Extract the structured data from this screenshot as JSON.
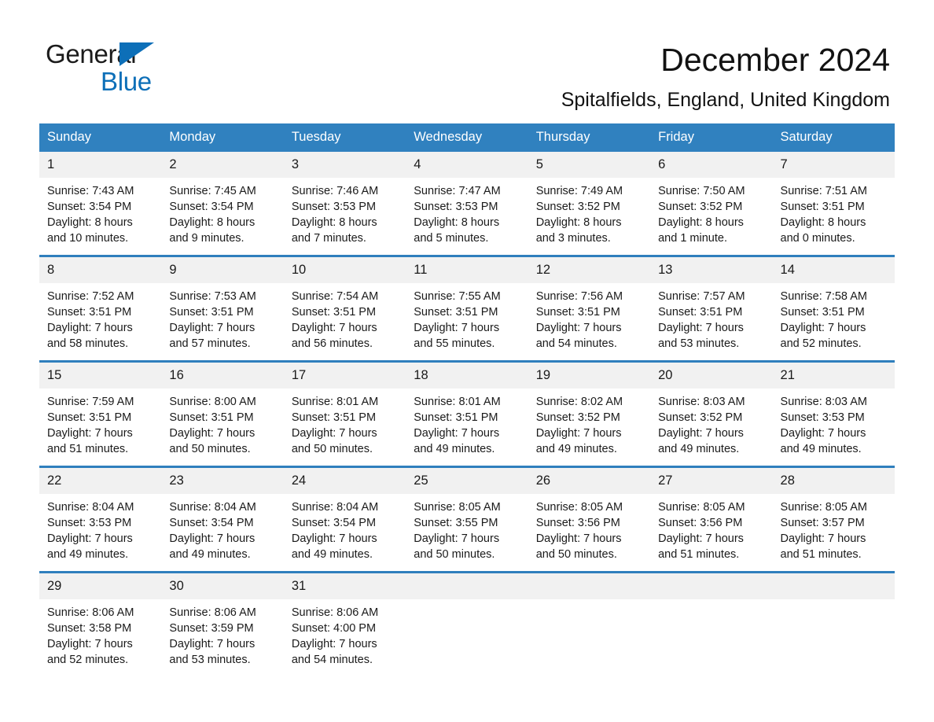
{
  "brand": {
    "name_part1": "General",
    "name_part2": "Blue",
    "flag_icon": "triangle-flag-icon",
    "accent_color": "#0d6fb8"
  },
  "header": {
    "title": "December 2024",
    "subtitle": "Spitalfields, England, United Kingdom"
  },
  "calendar": {
    "header_bg_color": "#3081bf",
    "daynum_bg_color": "#f1f1f1",
    "row_divider_color": "#2f7fbd",
    "weekday_headers": [
      "Sunday",
      "Monday",
      "Tuesday",
      "Wednesday",
      "Thursday",
      "Friday",
      "Saturday"
    ],
    "weeks": [
      [
        {
          "day": "1",
          "sunrise": "Sunrise: 7:43 AM",
          "sunset": "Sunset: 3:54 PM",
          "daylight_line1": "Daylight: 8 hours",
          "daylight_line2": "and 10 minutes."
        },
        {
          "day": "2",
          "sunrise": "Sunrise: 7:45 AM",
          "sunset": "Sunset: 3:54 PM",
          "daylight_line1": "Daylight: 8 hours",
          "daylight_line2": "and 9 minutes."
        },
        {
          "day": "3",
          "sunrise": "Sunrise: 7:46 AM",
          "sunset": "Sunset: 3:53 PM",
          "daylight_line1": "Daylight: 8 hours",
          "daylight_line2": "and 7 minutes."
        },
        {
          "day": "4",
          "sunrise": "Sunrise: 7:47 AM",
          "sunset": "Sunset: 3:53 PM",
          "daylight_line1": "Daylight: 8 hours",
          "daylight_line2": "and 5 minutes."
        },
        {
          "day": "5",
          "sunrise": "Sunrise: 7:49 AM",
          "sunset": "Sunset: 3:52 PM",
          "daylight_line1": "Daylight: 8 hours",
          "daylight_line2": "and 3 minutes."
        },
        {
          "day": "6",
          "sunrise": "Sunrise: 7:50 AM",
          "sunset": "Sunset: 3:52 PM",
          "daylight_line1": "Daylight: 8 hours",
          "daylight_line2": "and 1 minute."
        },
        {
          "day": "7",
          "sunrise": "Sunrise: 7:51 AM",
          "sunset": "Sunset: 3:51 PM",
          "daylight_line1": "Daylight: 8 hours",
          "daylight_line2": "and 0 minutes."
        }
      ],
      [
        {
          "day": "8",
          "sunrise": "Sunrise: 7:52 AM",
          "sunset": "Sunset: 3:51 PM",
          "daylight_line1": "Daylight: 7 hours",
          "daylight_line2": "and 58 minutes."
        },
        {
          "day": "9",
          "sunrise": "Sunrise: 7:53 AM",
          "sunset": "Sunset: 3:51 PM",
          "daylight_line1": "Daylight: 7 hours",
          "daylight_line2": "and 57 minutes."
        },
        {
          "day": "10",
          "sunrise": "Sunrise: 7:54 AM",
          "sunset": "Sunset: 3:51 PM",
          "daylight_line1": "Daylight: 7 hours",
          "daylight_line2": "and 56 minutes."
        },
        {
          "day": "11",
          "sunrise": "Sunrise: 7:55 AM",
          "sunset": "Sunset: 3:51 PM",
          "daylight_line1": "Daylight: 7 hours",
          "daylight_line2": "and 55 minutes."
        },
        {
          "day": "12",
          "sunrise": "Sunrise: 7:56 AM",
          "sunset": "Sunset: 3:51 PM",
          "daylight_line1": "Daylight: 7 hours",
          "daylight_line2": "and 54 minutes."
        },
        {
          "day": "13",
          "sunrise": "Sunrise: 7:57 AM",
          "sunset": "Sunset: 3:51 PM",
          "daylight_line1": "Daylight: 7 hours",
          "daylight_line2": "and 53 minutes."
        },
        {
          "day": "14",
          "sunrise": "Sunrise: 7:58 AM",
          "sunset": "Sunset: 3:51 PM",
          "daylight_line1": "Daylight: 7 hours",
          "daylight_line2": "and 52 minutes."
        }
      ],
      [
        {
          "day": "15",
          "sunrise": "Sunrise: 7:59 AM",
          "sunset": "Sunset: 3:51 PM",
          "daylight_line1": "Daylight: 7 hours",
          "daylight_line2": "and 51 minutes."
        },
        {
          "day": "16",
          "sunrise": "Sunrise: 8:00 AM",
          "sunset": "Sunset: 3:51 PM",
          "daylight_line1": "Daylight: 7 hours",
          "daylight_line2": "and 50 minutes."
        },
        {
          "day": "17",
          "sunrise": "Sunrise: 8:01 AM",
          "sunset": "Sunset: 3:51 PM",
          "daylight_line1": "Daylight: 7 hours",
          "daylight_line2": "and 50 minutes."
        },
        {
          "day": "18",
          "sunrise": "Sunrise: 8:01 AM",
          "sunset": "Sunset: 3:51 PM",
          "daylight_line1": "Daylight: 7 hours",
          "daylight_line2": "and 49 minutes."
        },
        {
          "day": "19",
          "sunrise": "Sunrise: 8:02 AM",
          "sunset": "Sunset: 3:52 PM",
          "daylight_line1": "Daylight: 7 hours",
          "daylight_line2": "and 49 minutes."
        },
        {
          "day": "20",
          "sunrise": "Sunrise: 8:03 AM",
          "sunset": "Sunset: 3:52 PM",
          "daylight_line1": "Daylight: 7 hours",
          "daylight_line2": "and 49 minutes."
        },
        {
          "day": "21",
          "sunrise": "Sunrise: 8:03 AM",
          "sunset": "Sunset: 3:53 PM",
          "daylight_line1": "Daylight: 7 hours",
          "daylight_line2": "and 49 minutes."
        }
      ],
      [
        {
          "day": "22",
          "sunrise": "Sunrise: 8:04 AM",
          "sunset": "Sunset: 3:53 PM",
          "daylight_line1": "Daylight: 7 hours",
          "daylight_line2": "and 49 minutes."
        },
        {
          "day": "23",
          "sunrise": "Sunrise: 8:04 AM",
          "sunset": "Sunset: 3:54 PM",
          "daylight_line1": "Daylight: 7 hours",
          "daylight_line2": "and 49 minutes."
        },
        {
          "day": "24",
          "sunrise": "Sunrise: 8:04 AM",
          "sunset": "Sunset: 3:54 PM",
          "daylight_line1": "Daylight: 7 hours",
          "daylight_line2": "and 49 minutes."
        },
        {
          "day": "25",
          "sunrise": "Sunrise: 8:05 AM",
          "sunset": "Sunset: 3:55 PM",
          "daylight_line1": "Daylight: 7 hours",
          "daylight_line2": "and 50 minutes."
        },
        {
          "day": "26",
          "sunrise": "Sunrise: 8:05 AM",
          "sunset": "Sunset: 3:56 PM",
          "daylight_line1": "Daylight: 7 hours",
          "daylight_line2": "and 50 minutes."
        },
        {
          "day": "27",
          "sunrise": "Sunrise: 8:05 AM",
          "sunset": "Sunset: 3:56 PM",
          "daylight_line1": "Daylight: 7 hours",
          "daylight_line2": "and 51 minutes."
        },
        {
          "day": "28",
          "sunrise": "Sunrise: 8:05 AM",
          "sunset": "Sunset: 3:57 PM",
          "daylight_line1": "Daylight: 7 hours",
          "daylight_line2": "and 51 minutes."
        }
      ],
      [
        {
          "day": "29",
          "sunrise": "Sunrise: 8:06 AM",
          "sunset": "Sunset: 3:58 PM",
          "daylight_line1": "Daylight: 7 hours",
          "daylight_line2": "and 52 minutes."
        },
        {
          "day": "30",
          "sunrise": "Sunrise: 8:06 AM",
          "sunset": "Sunset: 3:59 PM",
          "daylight_line1": "Daylight: 7 hours",
          "daylight_line2": "and 53 minutes."
        },
        {
          "day": "31",
          "sunrise": "Sunrise: 8:06 AM",
          "sunset": "Sunset: 4:00 PM",
          "daylight_line1": "Daylight: 7 hours",
          "daylight_line2": "and 54 minutes."
        },
        {
          "day": "",
          "sunrise": "",
          "sunset": "",
          "daylight_line1": "",
          "daylight_line2": ""
        },
        {
          "day": "",
          "sunrise": "",
          "sunset": "",
          "daylight_line1": "",
          "daylight_line2": ""
        },
        {
          "day": "",
          "sunrise": "",
          "sunset": "",
          "daylight_line1": "",
          "daylight_line2": ""
        },
        {
          "day": "",
          "sunrise": "",
          "sunset": "",
          "daylight_line1": "",
          "daylight_line2": ""
        }
      ]
    ]
  }
}
